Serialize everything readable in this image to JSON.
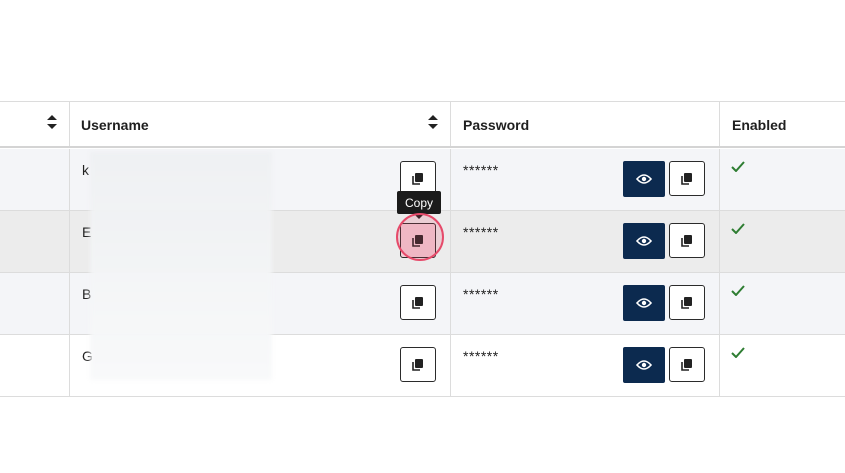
{
  "header": {
    "username_label": "Username",
    "password_label": "Password",
    "enabled_label": "Enabled"
  },
  "rows": [
    {
      "username": "k",
      "password": "******",
      "enabled": true
    },
    {
      "username": "E",
      "password": "******",
      "enabled": true
    },
    {
      "username": "B",
      "password": "******",
      "enabled": true
    },
    {
      "username": "G",
      "password": "******",
      "enabled": true
    }
  ],
  "tooltip": {
    "text": "Copy"
  },
  "colors": {
    "primary": "#0c2a4f",
    "check": "#2e7d32",
    "highlight": "#e64a6a"
  },
  "icons": [
    "sort-icon",
    "copy-icon",
    "eye-icon",
    "check-icon"
  ]
}
